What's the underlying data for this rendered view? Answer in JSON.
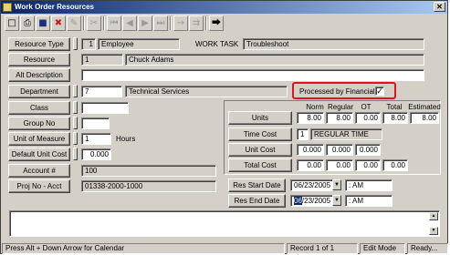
{
  "window": {
    "title": "Work Order Resources",
    "close_glyph": "✕"
  },
  "toolbar": {
    "buttons": [
      {
        "name": "new-record-button",
        "glyph": "□",
        "disabled": false
      },
      {
        "name": "print-button",
        "glyph": "⎙",
        "disabled": false
      },
      {
        "name": "save-button",
        "glyph": "■",
        "disabled": false
      },
      {
        "name": "delete-button",
        "glyph": "✖",
        "disabled": false
      },
      {
        "name": "edit-button",
        "glyph": "✎",
        "disabled": true
      },
      {
        "name": "cut-button",
        "glyph": "✂",
        "disabled": true
      },
      {
        "name": "first-record-button",
        "glyph": "⏮",
        "disabled": true
      },
      {
        "name": "previous-record-button",
        "glyph": "◀",
        "disabled": true
      },
      {
        "name": "next-record-button",
        "glyph": "▶",
        "disabled": true
      },
      {
        "name": "last-record-button",
        "glyph": "⏭",
        "disabled": true
      },
      {
        "name": "goto-button",
        "glyph": "→",
        "disabled": true
      },
      {
        "name": "filter-button",
        "glyph": "⇉",
        "disabled": true
      },
      {
        "name": "exit-button",
        "glyph": "⮕",
        "disabled": false
      }
    ]
  },
  "form": {
    "resource_type": {
      "label": "Resource Type",
      "code": "1",
      "value": "Employee"
    },
    "work_task": {
      "label": "WORK TASK",
      "value": "Troubleshoot"
    },
    "resource": {
      "label": "Resource",
      "code": "1",
      "value": "Chuck Adams"
    },
    "alt_description": {
      "label": "Alt Description",
      "value": ""
    },
    "department": {
      "label": "Department",
      "code": "7",
      "value": "Technical Services"
    },
    "processed_by_financials": {
      "label": "Processed by Financials",
      "checked": true,
      "check_glyph": "✓"
    },
    "class": {
      "label": "Class",
      "value": ""
    },
    "group_no": {
      "label": "Group No",
      "value": ""
    },
    "unit_of_measure": {
      "label": "Unit of Measure",
      "code": "1",
      "value": "Hours"
    },
    "default_unit_cost": {
      "label": "Default Unit Cost",
      "value": "0.000"
    },
    "account": {
      "label": "Account #",
      "value": "100"
    },
    "proj_no_acct": {
      "label": "Proj No - Acct",
      "value": "01338-2000-1000"
    }
  },
  "cost_grid": {
    "columns": [
      "Norm",
      "Regular",
      "OT",
      "Total",
      "Estimated"
    ],
    "units": {
      "label": "Units",
      "norm": "8.00",
      "regular": "8.00",
      "ot": "0.00",
      "total": "8.00",
      "estimated": "8.00"
    },
    "time_cost": {
      "label": "Time Cost",
      "code": "1",
      "value": "REGULAR TIME"
    },
    "unit_cost": {
      "label": "Unit Cost",
      "norm": "0.000",
      "regular": "0.000",
      "ot": "0.000"
    },
    "total_cost": {
      "label": "Total Cost",
      "norm": "0.00",
      "regular": "0.00",
      "ot": "0.00",
      "total": "0.00"
    }
  },
  "dates": {
    "res_start": {
      "label": "Res Start Date",
      "date": "06/23/2005",
      "time": ":  AM"
    },
    "res_end": {
      "label": "Res End Date",
      "date_sel": "06",
      "date_rest": "/23/2005",
      "time": ":  AM"
    },
    "dropdown_glyph": "▼"
  },
  "status": {
    "hint": "Press Alt + Down Arrow for Calendar",
    "record": "Record 1 of 1",
    "mode": "Edit Mode",
    "state": "Ready..."
  },
  "scroll": {
    "up_glyph": "▲",
    "down_glyph": "▼"
  },
  "colors": {
    "title_start": "#0a246a",
    "title_end": "#a6caf0",
    "highlight": "#e0141e",
    "face": "#d4d0c8"
  }
}
